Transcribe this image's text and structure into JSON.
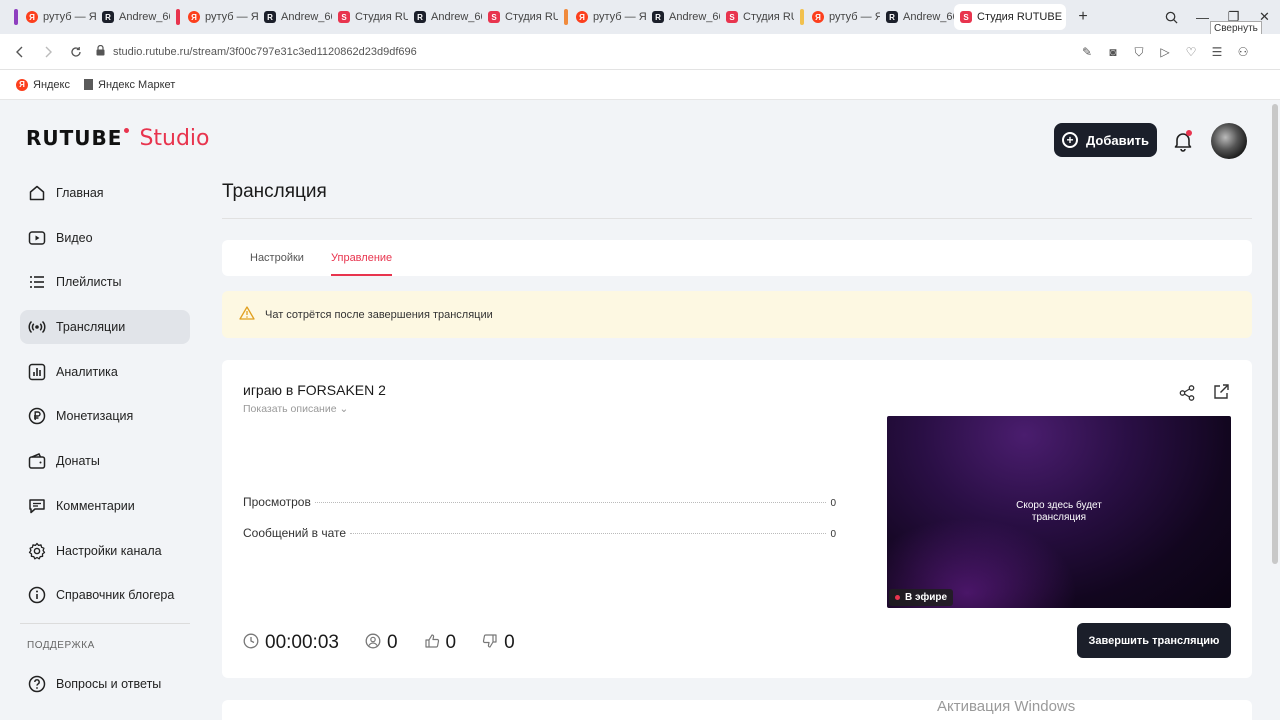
{
  "browser": {
    "tabs": [
      {
        "label": "рутуб — Я",
        "icon": "yandex",
        "group": "#8e3fbf"
      },
      {
        "label": "Andrew_66",
        "icon": "rutube"
      },
      {
        "label": "рутуб — Я",
        "icon": "yandex",
        "group": "#e8344e"
      },
      {
        "label": "Andrew_66",
        "icon": "rutube"
      },
      {
        "label": "Студия RU",
        "icon": "studio"
      },
      {
        "label": "Andrew_66",
        "icon": "rutube"
      },
      {
        "label": "Студия RU",
        "icon": "studio"
      },
      {
        "label": "рутуб — Я",
        "icon": "yandex",
        "group": "#f08a3c"
      },
      {
        "label": "Andrew_66",
        "icon": "rutube"
      },
      {
        "label": "Студия RU",
        "icon": "studio"
      },
      {
        "label": "рутуб — Я",
        "icon": "yandex",
        "group": "#f2c14e"
      },
      {
        "label": "Andrew_66",
        "icon": "rutube"
      },
      {
        "label": "Студия RUTUBE",
        "icon": "studio",
        "active": true
      }
    ],
    "tooltip": "Свернуть",
    "url": "studio.rutube.ru/stream/3f00c797e31c3ed1120862d23d9df696",
    "bookmarks": {
      "yandex": "Яндекс",
      "market": "Яндекс Маркет"
    }
  },
  "header": {
    "logo_main": "RUTUBE",
    "logo_studio": "Studio",
    "add_label": "Добавить"
  },
  "sidebar": {
    "items": [
      {
        "label": "Главная",
        "icon": "home-icon"
      },
      {
        "label": "Видео",
        "icon": "video-icon"
      },
      {
        "label": "Плейлисты",
        "icon": "playlist-icon"
      },
      {
        "label": "Трансляции",
        "icon": "broadcast-icon",
        "active": true
      },
      {
        "label": "Аналитика",
        "icon": "analytics-icon"
      },
      {
        "label": "Монетизация",
        "icon": "ruble-icon"
      },
      {
        "label": "Донаты",
        "icon": "wallet-icon"
      },
      {
        "label": "Комментарии",
        "icon": "comment-icon"
      },
      {
        "label": "Настройки канала",
        "icon": "gear-icon"
      },
      {
        "label": "Справочник блогера",
        "icon": "info-icon"
      }
    ],
    "support_title": "ПОДДЕРЖКА",
    "support_items": [
      {
        "label": "Вопросы и ответы",
        "icon": "question-icon"
      }
    ]
  },
  "main": {
    "page_title": "Трансляция",
    "tabs": [
      {
        "label": "Настройки"
      },
      {
        "label": "Управление",
        "active": true
      }
    ],
    "warning": "Чат сотрётся после завершения трансляции",
    "stream": {
      "title": "играю в FORSAKEN 2",
      "show_description": "Показать описание",
      "stats": [
        {
          "label": "Просмотров",
          "value": "0"
        },
        {
          "label": "Сообщений в чате",
          "value": "0"
        }
      ],
      "timer": "00:00:03",
      "viewers": "0",
      "likes": "0",
      "dislikes": "0",
      "player_text": "Скоро здесь будет трансляция",
      "live_label": "В эфире",
      "end_button": "Завершить трансляцию"
    }
  },
  "os_watermark": "Активация Windows",
  "colors": {
    "accent": "#e8344e",
    "dark": "#1b1f2a",
    "warning_bg": "#fdf8e2"
  }
}
